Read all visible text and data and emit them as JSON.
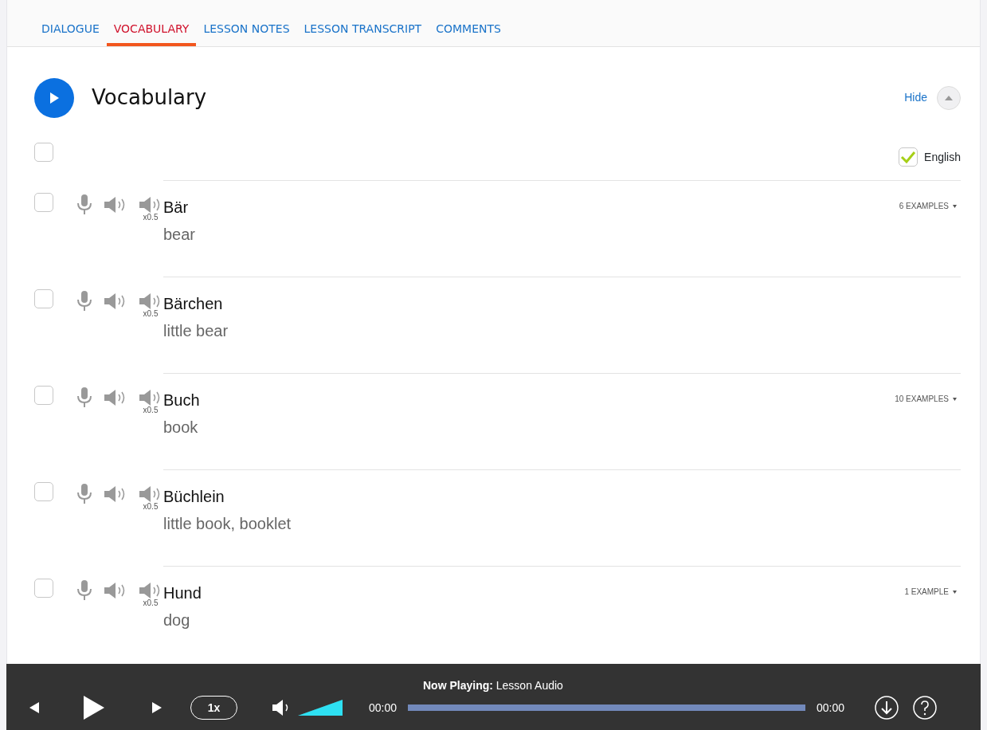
{
  "tabs": [
    {
      "label": "DIALOGUE",
      "selected": false
    },
    {
      "label": "VOCABULARY",
      "selected": true
    },
    {
      "label": "LESSON NOTES",
      "selected": false
    },
    {
      "label": "LESSON TRANSCRIPT",
      "selected": false
    },
    {
      "label": "COMMENTS",
      "selected": false
    }
  ],
  "section": {
    "title": "Vocabulary",
    "hide_label": "Hide"
  },
  "select_all": {
    "checked": false
  },
  "english": {
    "label": "English",
    "checked": true
  },
  "words": [
    {
      "word": "Bär",
      "translation": "bear",
      "slow_label": "x0.5",
      "examples": "6 EXAMPLES",
      "checked": false
    },
    {
      "word": "Bärchen",
      "translation": "little bear",
      "slow_label": "x0.5",
      "checked": false
    },
    {
      "word": "Buch",
      "translation": "book",
      "slow_label": "x0.5",
      "examples": "10 EXAMPLES",
      "checked": false
    },
    {
      "word": "Büchlein",
      "translation": "little book, booklet",
      "slow_label": "x0.5",
      "checked": false
    },
    {
      "word": "Hund",
      "translation": "dog",
      "slow_label": "x0.5",
      "examples": "1 EXAMPLE",
      "checked": false
    }
  ],
  "player": {
    "now_playing_label": "Now Playing:",
    "now_playing": "Lesson Audio",
    "speed": "1x",
    "volume": {
      "level": 1
    },
    "progress": {
      "level": 1
    },
    "time_start": "00:00",
    "time_end": "00:00"
  }
}
